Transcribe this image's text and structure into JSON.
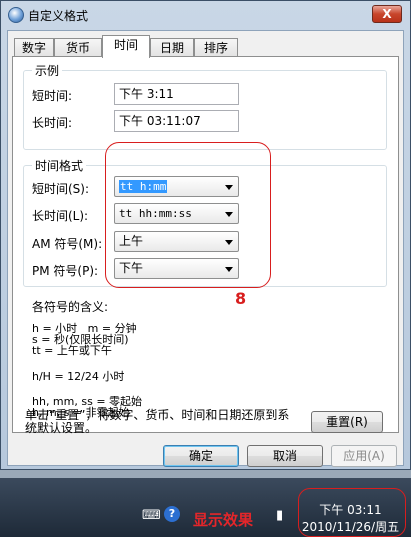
{
  "window": {
    "title": "自定义格式",
    "close_label": "X"
  },
  "tabs": [
    "数字",
    "货币",
    "时间",
    "日期",
    "排序"
  ],
  "active_tab": "时间",
  "example": {
    "title": "示例",
    "short_label": "短时间:",
    "short_value": "下午 3:11",
    "long_label": "长时间:",
    "long_value": "下午 03:11:07"
  },
  "time_format": {
    "title": "时间格式",
    "short_label": "短时间(S):",
    "short_value": "tt h:mm",
    "long_label": "长时间(L):",
    "long_value": "tt hh:mm:ss",
    "am_label": "AM 符号(M):",
    "am_value": "上午",
    "pm_label": "PM 符号(P):",
    "pm_value": "下午"
  },
  "help": {
    "heading": "各符号的含义:",
    "block1": "h = 小时   m = 分钟\ns = 秒(仅限长时间)\ntt = 上午或下午",
    "block2": "h/H = 12/24 小时",
    "block3": "hh, mm, ss = 零起始\nh, m, s = 非零起始"
  },
  "reset_text": "单击“重置”，将数字、货币、时间和日期还原到系\n统默认设置。",
  "buttons": {
    "reset": "重置(R)",
    "ok": "确定",
    "cancel": "取消",
    "apply": "应用(A)"
  },
  "annotations": {
    "number": "8",
    "show_effect": "显示效果"
  },
  "taskbar": {
    "time": "下午 03:11",
    "date": "2010/11/26/周五"
  },
  "icons": [
    "app-globe-icon",
    "close-icon",
    "dropdown-arrow-icon",
    "keyboard-icon",
    "help-icon",
    "network-icon"
  ],
  "colors": {
    "annotation_red": "#d81e1e",
    "selection_blue": "#3399ff"
  }
}
